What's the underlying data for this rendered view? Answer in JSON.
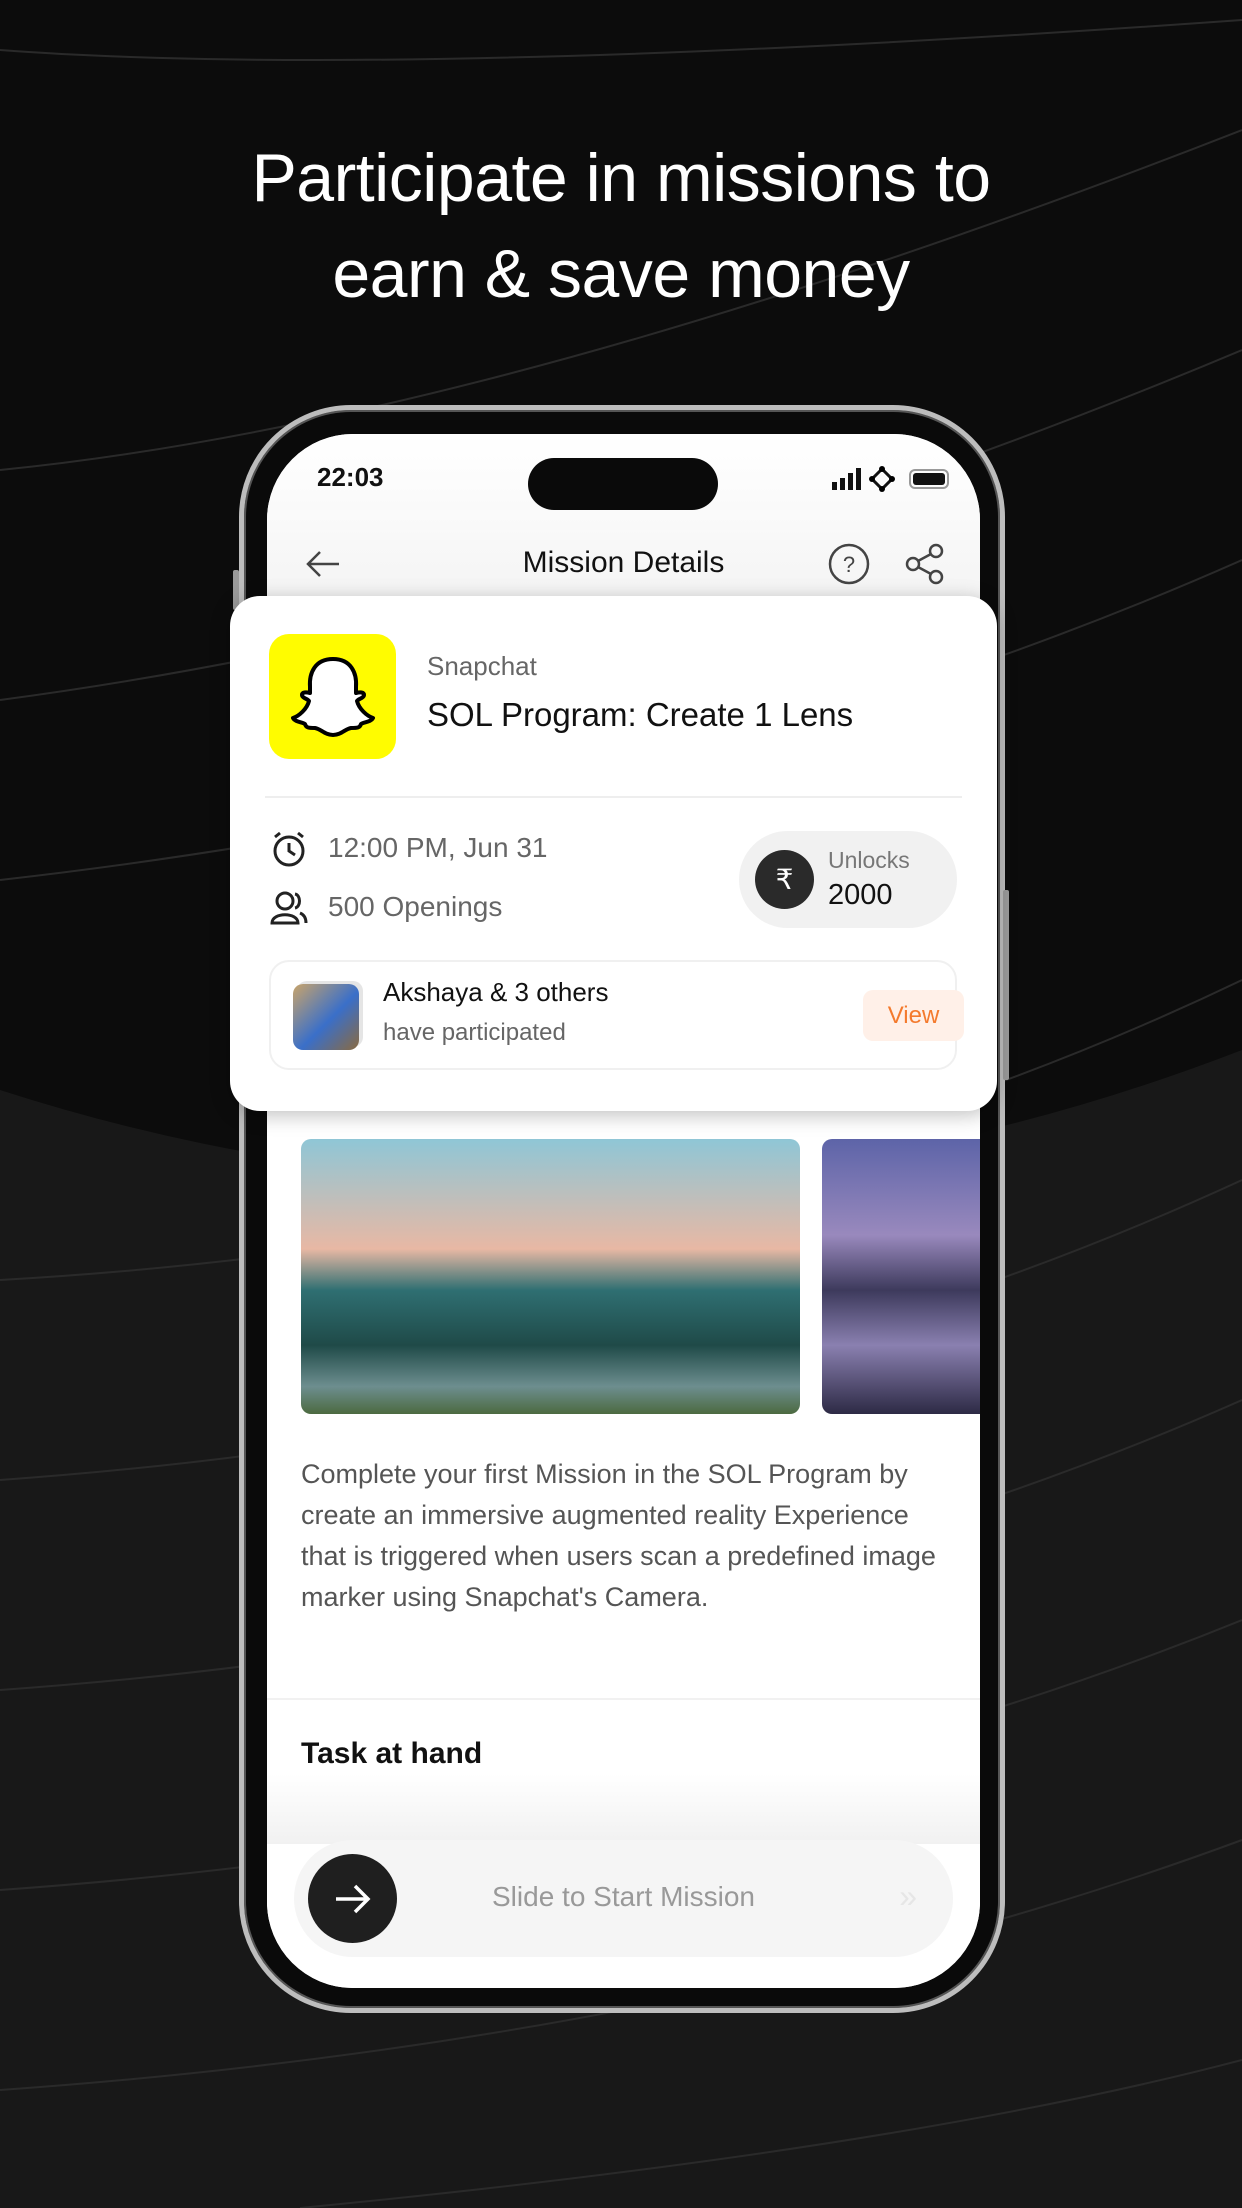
{
  "headline": {
    "line1": "Participate in missions to",
    "line2": "earn & save money"
  },
  "status_bar": {
    "time": "22:03"
  },
  "header": {
    "title": "Mission Details",
    "back_icon": "arrow-left-icon",
    "help_icon": "help-circle-icon",
    "share_icon": "share-icon"
  },
  "mission": {
    "brand": "Snapchat",
    "title": "SOL Program: Create 1 Lens",
    "brand_color": "#FFFC00",
    "deadline": "12:00 PM, Jun 31",
    "openings": "500 Openings",
    "unlocks_label": "Unlocks",
    "unlocks_value": "2000",
    "currency_symbol": "₹",
    "participants_title": "Akshaya & 3 others",
    "participants_sub": "have participated",
    "view_label": "View",
    "description": "Complete your first Mission in the SOL Program by create an immersive augmented reality Experience that is triggered when users scan a predefined image marker using Snapchat's Camera.",
    "task_heading": "Task at hand"
  },
  "slider": {
    "label": "Slide to Start Mission",
    "chevrons": "»"
  },
  "colors": {
    "accent": "#f47a2d",
    "background": "#0c0c0c"
  }
}
